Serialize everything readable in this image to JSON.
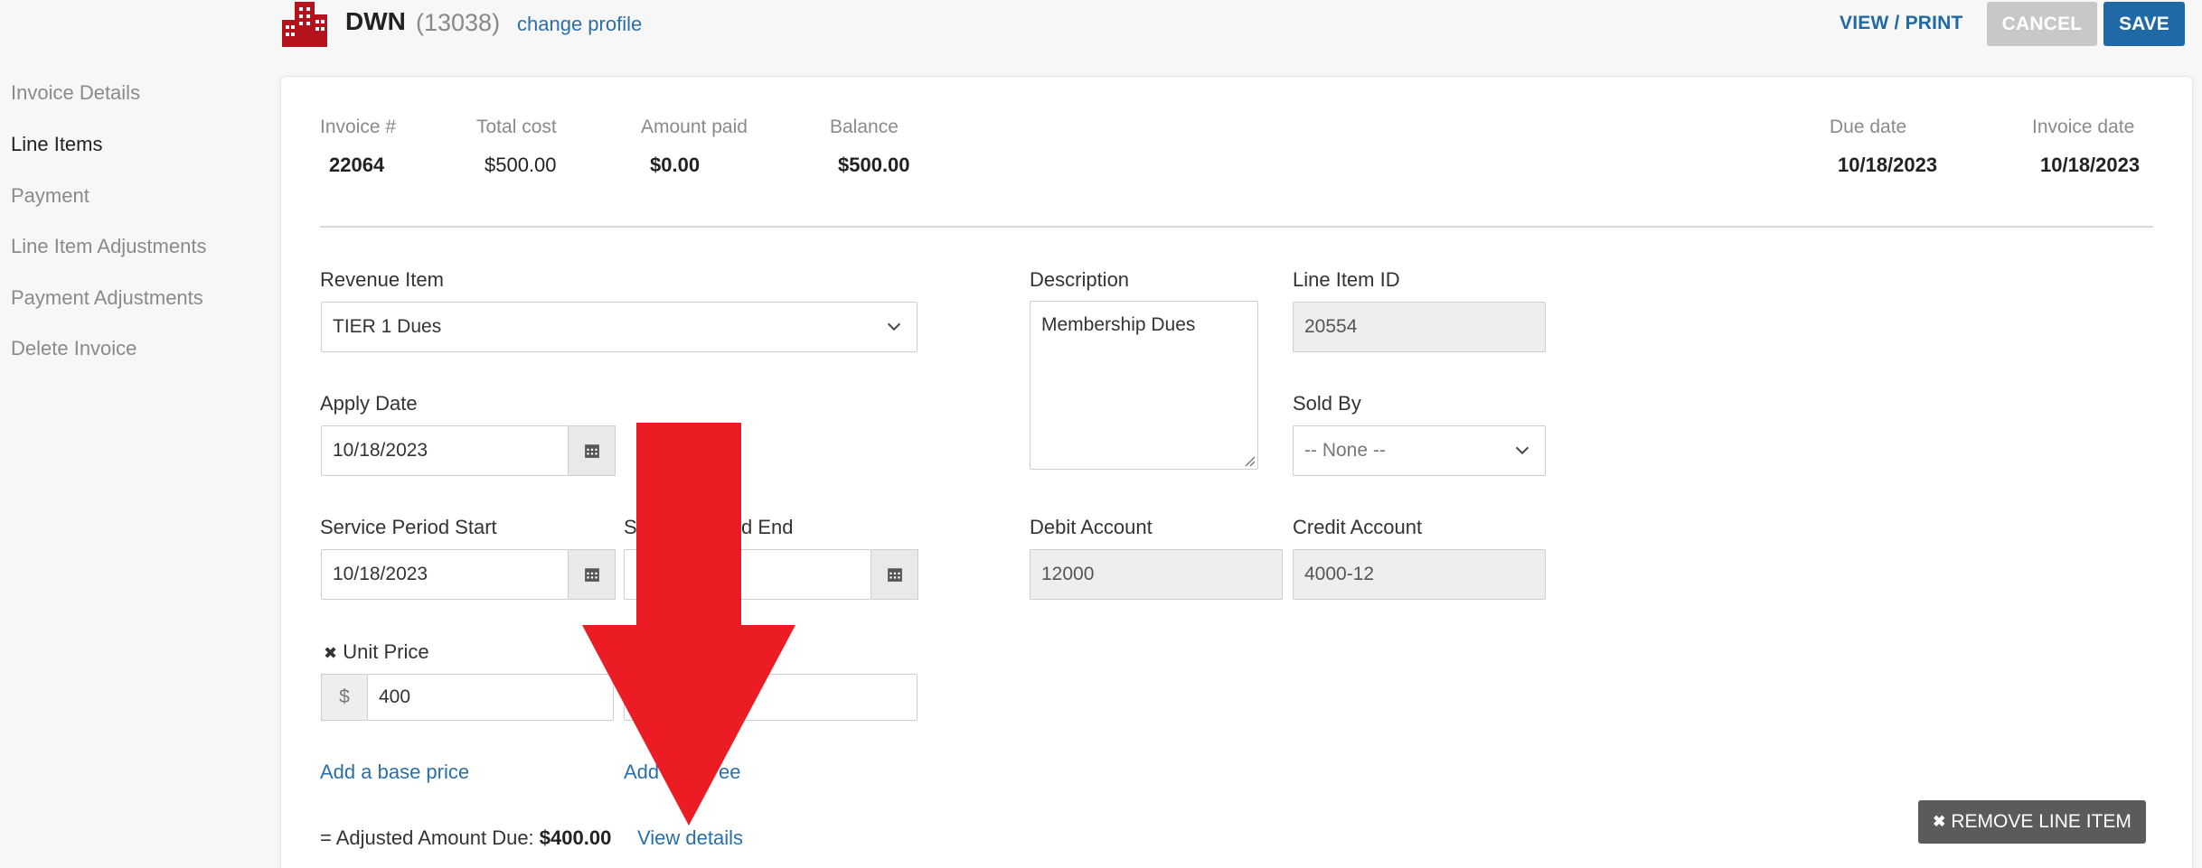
{
  "header": {
    "profile_name": "DWN",
    "profile_id": "(13038)",
    "change_profile": "change profile",
    "view_print": "VIEW / PRINT",
    "cancel": "CANCEL",
    "save": "SAVE"
  },
  "sidebar": {
    "items": [
      {
        "label": "Invoice Details"
      },
      {
        "label": "Line Items"
      },
      {
        "label": "Payment"
      },
      {
        "label": "Line Item Adjustments"
      },
      {
        "label": "Payment Adjustments"
      },
      {
        "label": "Delete Invoice"
      }
    ],
    "active": "Line Items"
  },
  "summary": {
    "invoice_label": "Invoice #",
    "invoice_value": "22064",
    "total_label": "Total cost",
    "total_value": "$500.00",
    "paid_label": "Amount paid",
    "paid_value": "$0.00",
    "balance_label": "Balance",
    "balance_value": "$500.00",
    "due_label": "Due date",
    "due_value": "10/18/2023",
    "invoice_date_label": "Invoice date",
    "invoice_date_value": "10/18/2023"
  },
  "form": {
    "revenue_item_label": "Revenue Item",
    "revenue_item_value": "TIER 1 Dues",
    "apply_date_label": "Apply Date",
    "apply_date_value": "10/18/2023",
    "service_start_label": "Service Period Start",
    "service_start_value": "10/18/2023",
    "service_end_label_visible": "S",
    "service_end_label_tail": "d End",
    "unit_price_label": "Unit Price",
    "unit_price_currency": "$",
    "unit_price_value": "400",
    "add_base_price": "Add a base price",
    "add_fee_head": "Add",
    "add_fee_tail": "ee",
    "description_label": "Description",
    "description_value": "Membership Dues",
    "line_item_id_label": "Line Item ID",
    "line_item_id_value": "20554",
    "sold_by_label": "Sold By",
    "sold_by_value": "-- None --",
    "debit_account_label": "Debit Account",
    "debit_account_value": "12000",
    "credit_account_label": "Credit Account",
    "credit_account_value": "4000-12",
    "adjusted_label": "= Adjusted Amount Due:",
    "adjusted_value": "$400.00",
    "view_details": "View details",
    "remove_line_item": "REMOVE LINE ITEM"
  },
  "colors": {
    "accent": "#1f6aa6",
    "link": "#2a6fa8",
    "arrow": "#ec1c24",
    "logo": "#b5121b"
  },
  "icons": [
    "building-logo-icon",
    "calendar-icon",
    "chevron-down-icon",
    "close-icon",
    "red-arrow-annotation"
  ]
}
